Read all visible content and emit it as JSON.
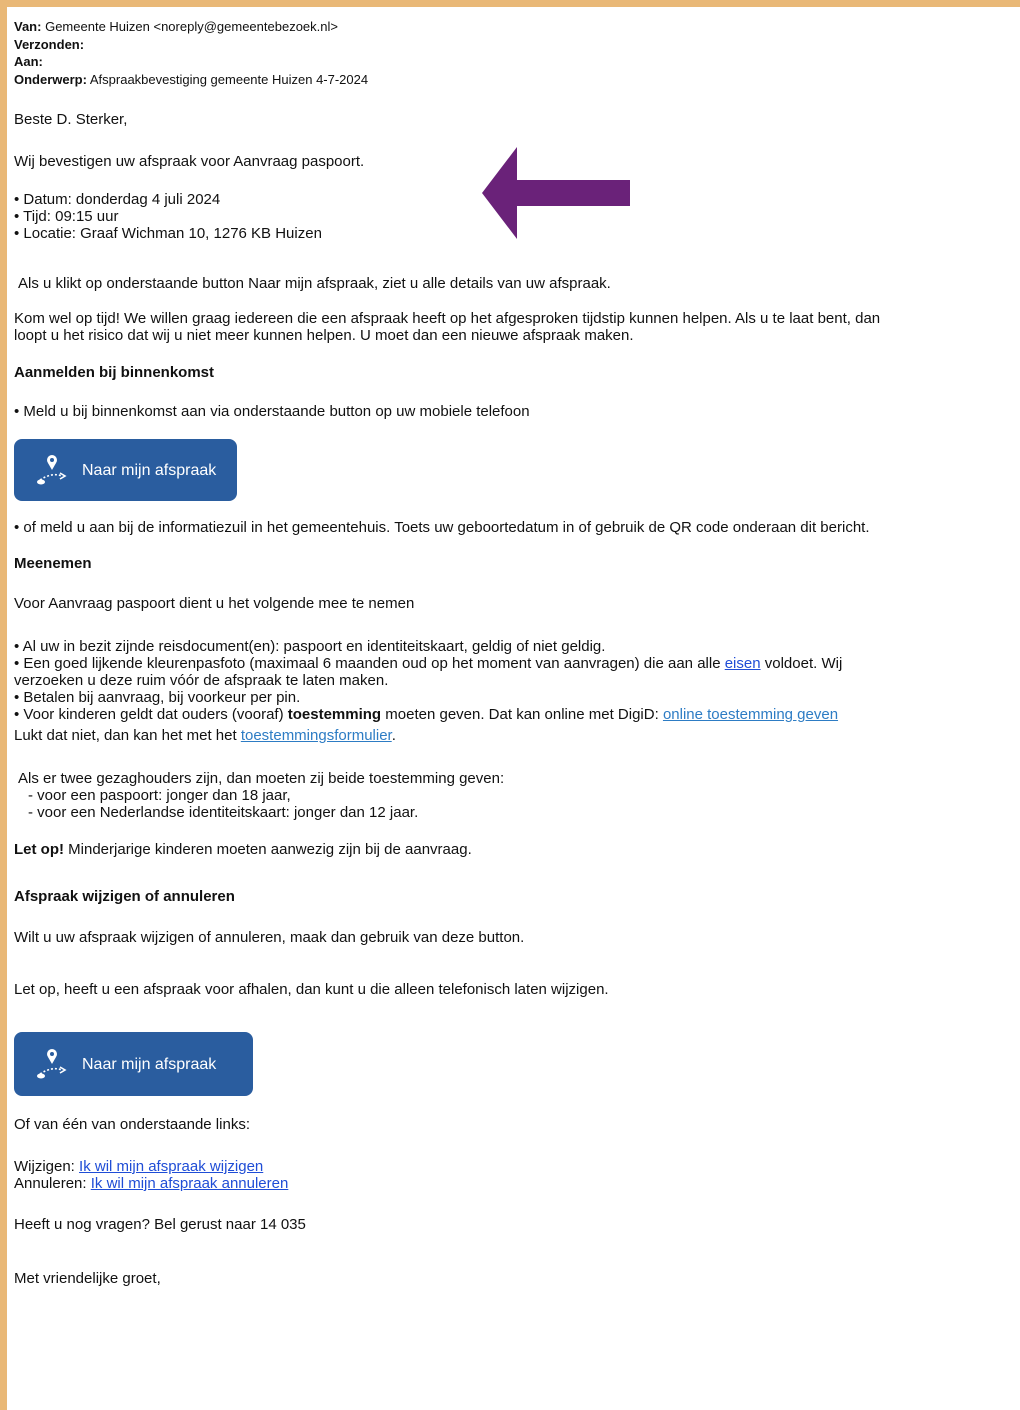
{
  "email": {
    "header": {
      "from_label": "Van:",
      "from_value": "Gemeente Huizen <noreply@gemeentebezoek.nl>",
      "sent_label": "Verzonden:",
      "to_label": "Aan:",
      "subject_label": "Onderwerp:",
      "subject_value": "Afspraakbevestiging gemeente Huizen 4-7-2024"
    },
    "greeting": "Beste D. Sterker,",
    "confirm": "Wij bevestigen uw afspraak voor Aanvraag paspoort.",
    "details": [
      "• Datum: donderdag 4 juli 2024",
      "• Tijd: 09:15 uur",
      "• Locatie: Graaf Wichman 10, 1276 KB Huizen"
    ],
    "click_info": "Als u klikt op onderstaande button Naar mijn afspraak, ziet u alle details van uw afspraak.",
    "on_time_1": "Kom wel op tijd! We willen graag iedereen die een afspraak heeft op het afgesproken tijdstip kunnen helpen. Als u te laat bent, dan",
    "on_time_2": "loopt u het risico dat wij u niet meer kunnen helpen. U moet dan een nieuwe afspraak maken.",
    "checkin_heading": "Aanmelden bij binnenkomst",
    "checkin_text": "• Meld u bij binnenkomst aan via onderstaande button op uw mobiele telefoon",
    "button_label": "Naar mijn afspraak",
    "checkin_alt": "• of meld u aan bij de informatiezuil in het gemeentehuis. Toets uw geboortedatum in of gebruik de QR code onderaan dit bericht.",
    "bring_heading": "Meenemen",
    "bring_intro": "Voor Aanvraag paspoort dient u het volgende mee te nemen",
    "bring_1": "• Al uw in bezit zijnde reisdocument(en): paspoort en identiteitskaart, geldig of niet geldig.",
    "bring_2a": "• Een goed lijkende kleurenpasfoto (maximaal 6 maanden oud op het moment van aanvragen) die aan alle ",
    "bring_2_link": "eisen",
    "bring_2b": " voldoet. Wij",
    "bring_2c": "verzoeken u deze ruim vóór de afspraak te laten maken.",
    "bring_3": "• Betalen bij aanvraag, bij voorkeur per pin.",
    "bring_4a": "• Voor kinderen geldt dat ouders (vooraf) ",
    "bring_4_bold": "toestemming",
    "bring_4b": " moeten geven. Dat kan online met DigiD: ",
    "bring_4_link": "online toestemming geven",
    "bring_5a": "Lukt dat niet, dan kan het met het ",
    "bring_5_link": "toestemmingsformulier",
    "bring_5b": ".",
    "guardians_1": "Als er twee gezaghouders zijn, dan moeten zij beide toestemming geven:",
    "guardians_2": "- voor een paspoort: jonger dan 18 jaar,",
    "guardians_3": "- voor een Nederlandse identiteitskaart: jonger dan 12 jaar.",
    "note_bold": "Let op!",
    "note_text": " Minderjarige kinderen moeten aanwezig zijn bij de aanvraag.",
    "change_heading": "Afspraak wijzigen of annuleren",
    "change_text": "Wilt u uw afspraak wijzigen of annuleren, maak dan gebruik van deze button.",
    "pickup_text": "Let op, heeft u een afspraak voor afhalen, dan kunt u die alleen telefonisch laten wijzigen.",
    "links_intro": "Of van één van onderstaande links:",
    "change_label": "Wijzigen: ",
    "change_link": "Ik wil mijn afspraak wijzigen",
    "cancel_label": "Annuleren: ",
    "cancel_link": "Ik wil mijn afspraak annuleren",
    "questions": "Heeft u nog vragen? Bel gerust naar 14 035",
    "closing": "Met vriendelijke groet,"
  },
  "colors": {
    "frame": "#e9b877",
    "button": "#2a5d9f",
    "arrow": "#6a2279",
    "link": "#1f4dd6"
  },
  "icons": [
    "location-pin-icon",
    "arrow-left-icon"
  ]
}
